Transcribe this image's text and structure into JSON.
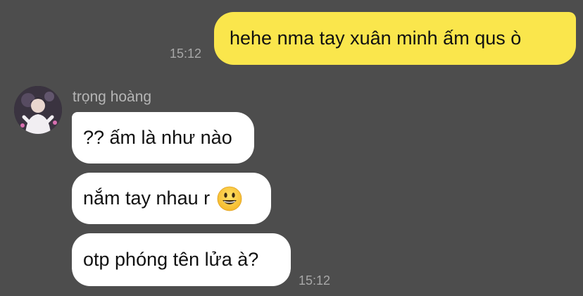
{
  "outgoing": {
    "text": "hehe nma tay xuân minh ấm qus ò",
    "time": "15:12"
  },
  "incoming": {
    "sender_name": "trọng hoàng",
    "messages": [
      {
        "text": "?? ấm là như nào"
      },
      {
        "text": "nắm tay nhau r",
        "emoji": "smiling-face-emoji"
      },
      {
        "text": "otp phóng tên lửa à?"
      }
    ],
    "time": "15:12"
  },
  "colors": {
    "background": "#4d4d4d",
    "outgoing_bubble": "#fae64c",
    "incoming_bubble": "#ffffff",
    "timestamp": "#a8a8a8"
  }
}
